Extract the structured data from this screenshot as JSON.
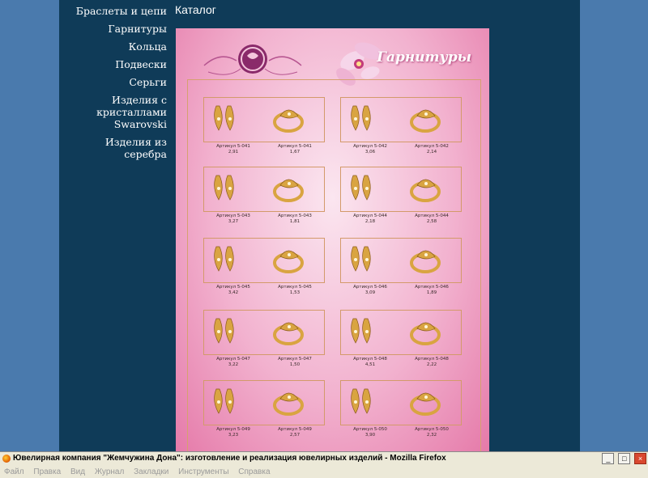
{
  "sidebar": {
    "items": [
      {
        "label": "Браслеты и цепи"
      },
      {
        "label": "Гарнитуры"
      },
      {
        "label": "Кольца"
      },
      {
        "label": "Подвески"
      },
      {
        "label": "Серьги"
      },
      {
        "label_lines": [
          "Изделия с",
          "кристаллами",
          "Swarovski"
        ]
      },
      {
        "label": "Изделия из серебра"
      }
    ]
  },
  "page": {
    "title": "Каталог"
  },
  "catalog": {
    "section_title": "Гарнитуры",
    "products": [
      {
        "earring_article": "Артикул 5-041",
        "earring_price": "2,91",
        "ring_article": "Артикул 5-041",
        "ring_price": "1,67"
      },
      {
        "earring_article": "Артикул 5-042",
        "earring_price": "3,06",
        "ring_article": "Артикул 5-042",
        "ring_price": "2,14"
      },
      {
        "earring_article": "Артикул 5-043",
        "earring_price": "3,27",
        "ring_article": "Артикул 5-043",
        "ring_price": "1,81"
      },
      {
        "earring_article": "Артикул 5-044",
        "earring_price": "2,18",
        "ring_article": "Артикул 5-044",
        "ring_price": "2,58"
      },
      {
        "earring_article": "Артикул 5-045",
        "earring_price": "3,42",
        "ring_article": "Артикул 5-045",
        "ring_price": "1,53"
      },
      {
        "earring_article": "Артикул 5-046",
        "earring_price": "3,09",
        "ring_article": "Артикул 5-046",
        "ring_price": "1,89"
      },
      {
        "earring_article": "Артикул 5-047",
        "earring_price": "3,22",
        "ring_article": "Артикул 5-047",
        "ring_price": "1,50"
      },
      {
        "earring_article": "Артикул 5-048",
        "earring_price": "4,51",
        "ring_article": "Артикул 5-048",
        "ring_price": "2,22"
      },
      {
        "earring_article": "Артикул 5-049",
        "earring_price": "3,23",
        "ring_article": "Артикул 5-049",
        "ring_price": "2,57"
      },
      {
        "earring_article": "Артикул 5-050",
        "earring_price": "3,90",
        "ring_article": "Артикул 5-050",
        "ring_price": "2,32"
      }
    ]
  },
  "window": {
    "title": "Ювелирная компания \"Жемчужина Дона\": изготовление и реализация ювелирных изделий - Mozilla Firefox",
    "minimize": "_",
    "maximize": "□",
    "close": "×"
  },
  "menubar": {
    "items": [
      "Файл",
      "Правка",
      "Вид",
      "Журнал",
      "Закладки",
      "Инструменты",
      "Справка"
    ]
  },
  "colors": {
    "page_bg": "#4a7aad",
    "content_bg": "#0f3b58",
    "catalog_pink": "#f2b2cf",
    "gold": "#d9a441"
  }
}
